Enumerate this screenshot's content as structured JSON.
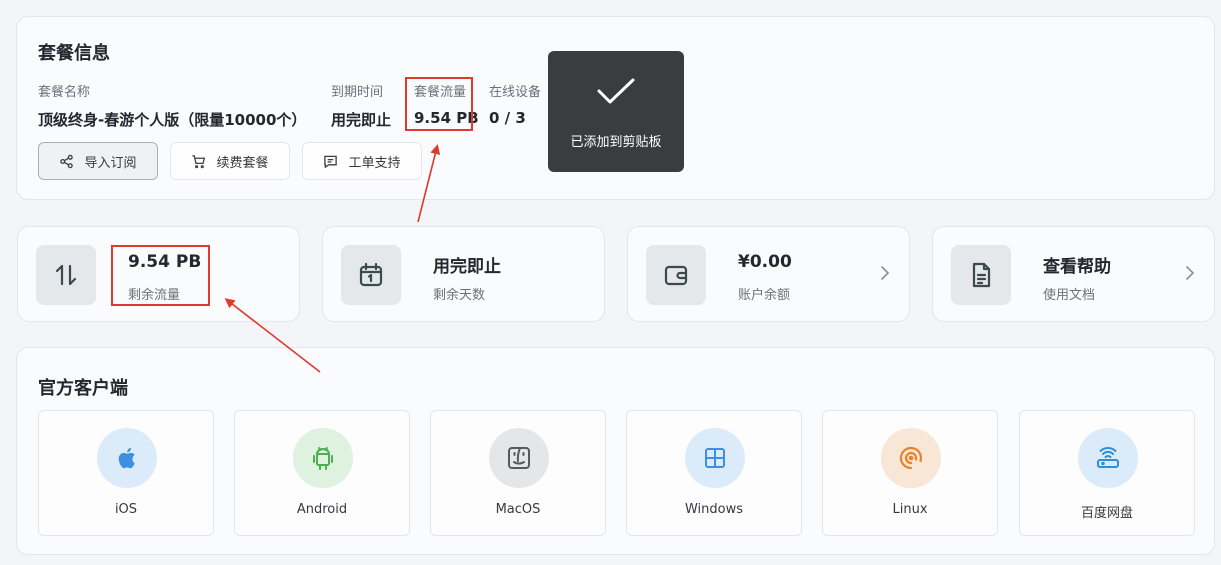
{
  "plan": {
    "title": "套餐信息",
    "fields": [
      {
        "label": "套餐名称",
        "value": "顶级终身-春游个人版（限量10000个）"
      },
      {
        "label": "到期时间",
        "value": "用完即止"
      },
      {
        "label": "套餐流量",
        "value": "9.54 PB"
      },
      {
        "label": "在线设备",
        "value": "0 / 3"
      }
    ],
    "buttons": {
      "import": "导入订阅",
      "renew": "续费套餐",
      "ticket": "工单支持"
    }
  },
  "toast": {
    "message": "已添加到剪贴板",
    "icon": "check-icon"
  },
  "stats": [
    {
      "value": "9.54 PB",
      "label": "剩余流量",
      "icon": "transfer-arrows-icon"
    },
    {
      "value": "用完即止",
      "label": "剩余天数",
      "icon": "calendar-icon"
    },
    {
      "value": "¥0.00",
      "label": "账户余额",
      "icon": "wallet-icon"
    },
    {
      "value": "查看帮助",
      "label": "使用文档",
      "icon": "document-icon"
    }
  ],
  "clients": {
    "title": "官方客户端",
    "items": [
      {
        "name": "iOS",
        "icon": "apple-icon",
        "color": "#3d8fe0"
      },
      {
        "name": "Android",
        "icon": "android-icon",
        "color": "#4caf50"
      },
      {
        "name": "MacOS",
        "icon": "finder-icon",
        "color": "#555a60"
      },
      {
        "name": "Windows",
        "icon": "windows-icon",
        "color": "#3d8fe0"
      },
      {
        "name": "Linux",
        "icon": "linux-icon",
        "color": "#e8822a"
      },
      {
        "name": "百度网盘",
        "icon": "router-icon",
        "color": "#2f8fd6"
      }
    ]
  },
  "colors": {
    "highlight": "#e03a2e",
    "accent": "#3a4a4d"
  }
}
